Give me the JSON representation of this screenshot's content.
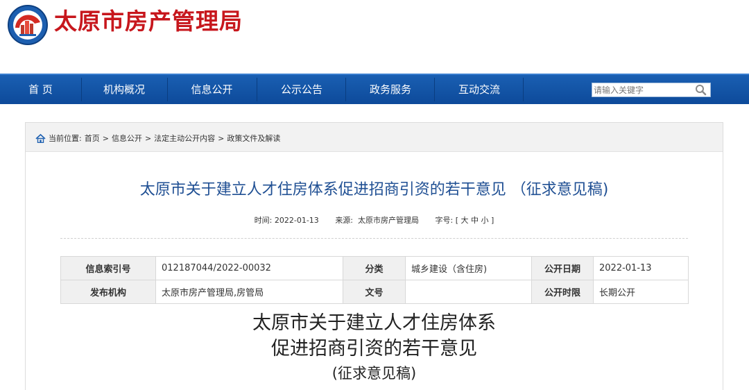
{
  "header": {
    "site_title": "太原市房产管理局",
    "logo_icon": "city-emblem-icon"
  },
  "nav": {
    "items": [
      "首 页",
      "机构概况",
      "信息公开",
      "公示公告",
      "政务服务",
      "互动交流"
    ],
    "search_placeholder": "请输入关键字",
    "search_icon": "magnifier-icon"
  },
  "breadcrumb": {
    "prefix": "当前位置:",
    "items": [
      "首页",
      "信息公开",
      "法定主动公开内容",
      "政策文件及解读"
    ],
    "separator": ">"
  },
  "article": {
    "title": "太原市关于建立人才住房体系促进招商引资的若干意见 （征求意见稿)",
    "time_label": "时间:",
    "time_value": "2022-01-13",
    "source_label": "来源:",
    "source_value": "太原市房产管理局",
    "font_label": "字号:",
    "font_sizes": "[ 大 中 小 ]"
  },
  "info_table": {
    "row1": {
      "label1": "信息索引号",
      "value1": "012187044/2022-00032",
      "label2": "分类",
      "value2": "城乡建设（含住房)",
      "label3": "公开日期",
      "value3": "2022-01-13"
    },
    "row2": {
      "label1": "发布机构",
      "value1": "太原市房产管理局,房管局",
      "label2": "文号",
      "value2": "",
      "label3": "公开时限",
      "value3": "长期公开"
    }
  },
  "document": {
    "title_line1": "太原市关于建立人才住房体系",
    "title_line2": "促进招商引资的若干意见",
    "subtitle": "(征求意见稿)"
  },
  "colors": {
    "title_red": "#c7171d",
    "nav_blue": "#0d4a9a",
    "article_title_blue": "#1f4f93"
  }
}
